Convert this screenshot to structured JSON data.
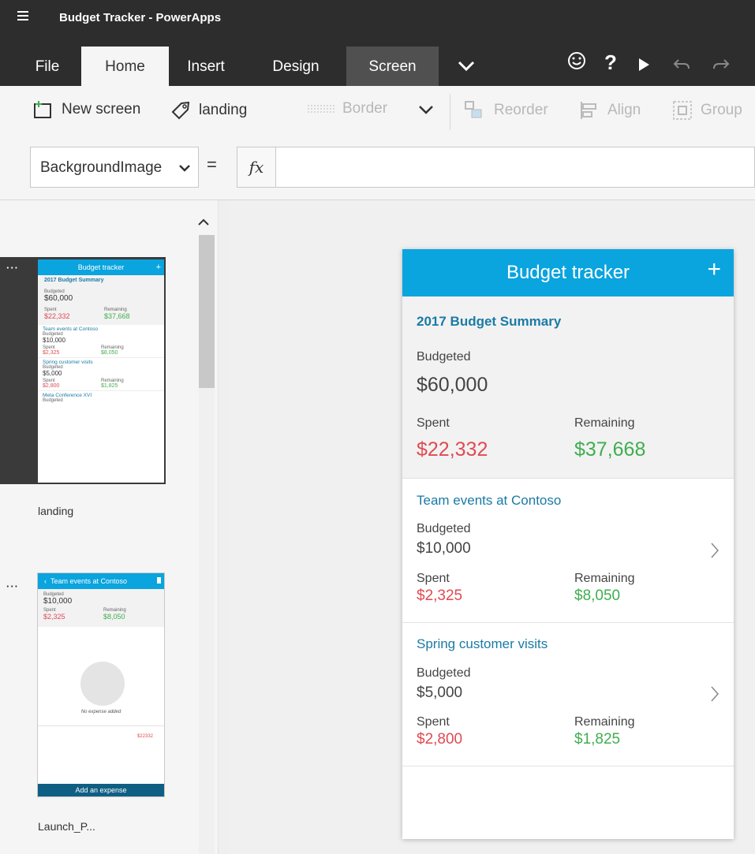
{
  "app": {
    "title": "Budget Tracker - PowerApps"
  },
  "ribbon": {
    "tabs": [
      "File",
      "Home",
      "Insert",
      "Design",
      "Screen"
    ],
    "icons": [
      "chevron-down-icon",
      "smiley-icon",
      "help-icon",
      "play-icon",
      "undo-icon",
      "redo-icon"
    ]
  },
  "toolbar": {
    "new_screen": "New screen",
    "landing": "landing",
    "border": "Border",
    "reorder": "Reorder",
    "align": "Align",
    "group": "Group"
  },
  "formula": {
    "property": "BackgroundImage",
    "equals": "=",
    "fx": "fx"
  },
  "screens": {
    "landing": {
      "name": "landing",
      "header": "Budget tracker",
      "summary_title": "2017 Budget Summary",
      "budgeted_label": "Budgeted",
      "budgeted": "$60,000",
      "spent_label": "Spent",
      "spent": "$22,332",
      "remaining_label": "Remaining",
      "remaining": "$37,668",
      "items": [
        {
          "title": "Team events at Contoso",
          "budgeted": "$10,000",
          "spent": "$2,325",
          "remaining": "$8,050"
        },
        {
          "title": "Spring customer visits",
          "budgeted": "$5,000",
          "spent": "$2,800",
          "remaining": "$1,825"
        },
        {
          "title": "Meta Conference XVI",
          "budgeted_label": "Budgeted"
        }
      ]
    },
    "launch": {
      "name": "Launch_P...",
      "header": "Team events at Contoso",
      "budgeted_label": "Budgeted",
      "budgeted": "$10,000",
      "spent_label": "Spent",
      "spent": "$2,325",
      "remaining_label": "Remaining",
      "remaining": "$8,050",
      "no_expense": "No expense added",
      "total": "$22332",
      "add_button": "Add an expense"
    }
  },
  "colors": {
    "header": "#0aa4de",
    "spent": "#e04a52",
    "remaining": "#3fae4f",
    "title_blue": "#1a7aa6"
  }
}
